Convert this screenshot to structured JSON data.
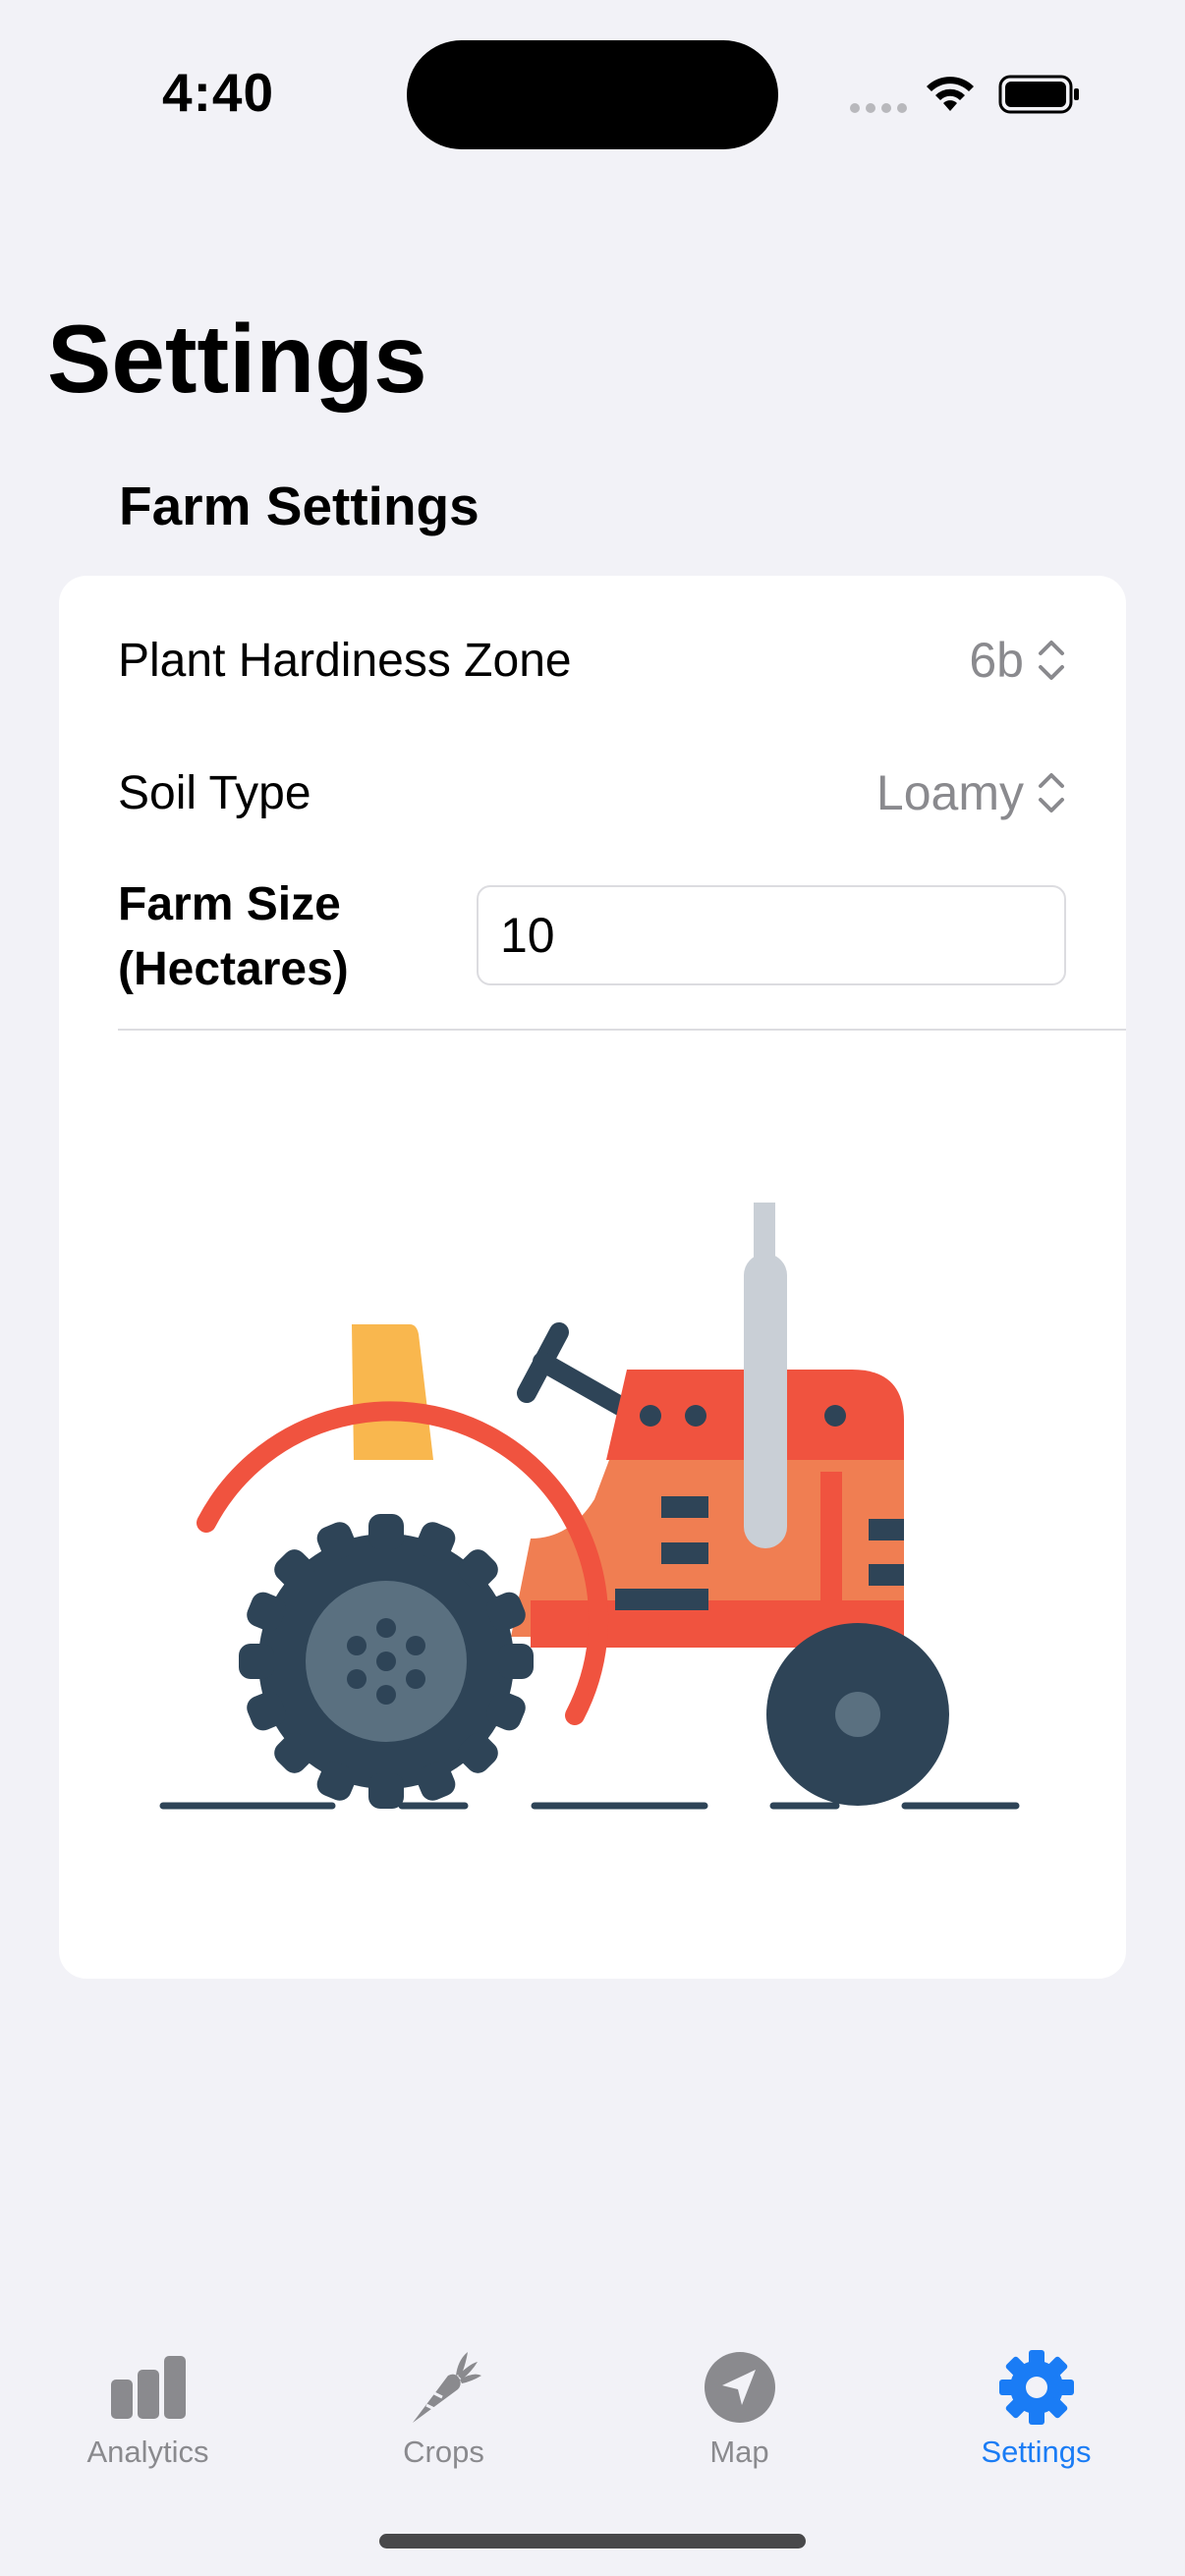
{
  "status_bar": {
    "time": "4:40"
  },
  "page": {
    "title": "Settings"
  },
  "farm_settings": {
    "header": "Farm Settings",
    "rows": [
      {
        "label": "Plant Hardiness Zone",
        "value": "6b"
      },
      {
        "label": "Soil Type",
        "value": "Loamy"
      }
    ],
    "farm_size": {
      "label": "Farm Size\n(Hectares)",
      "value": "10"
    }
  },
  "illustration": {
    "icon": "tractor-illustration",
    "colors": {
      "body": "#f07e52",
      "accent": "#f0533f",
      "wheel": "#2e4457",
      "hub": "#5a7080",
      "seat": "#f9b74e",
      "exhaust": "#c9cfd6"
    }
  },
  "tab_bar": {
    "tabs": [
      {
        "label": "Analytics",
        "icon": "bar-chart-icon",
        "active": false
      },
      {
        "label": "Crops",
        "icon": "carrot-icon",
        "active": false
      },
      {
        "label": "Map",
        "icon": "location-arrow-icon",
        "active": false
      },
      {
        "label": "Settings",
        "icon": "gear-icon",
        "active": true
      }
    ]
  },
  "colors": {
    "background": "#f2f2f7",
    "card": "#ffffff",
    "accent": "#1a7cf5",
    "secondary_text": "#8a8a8e"
  }
}
